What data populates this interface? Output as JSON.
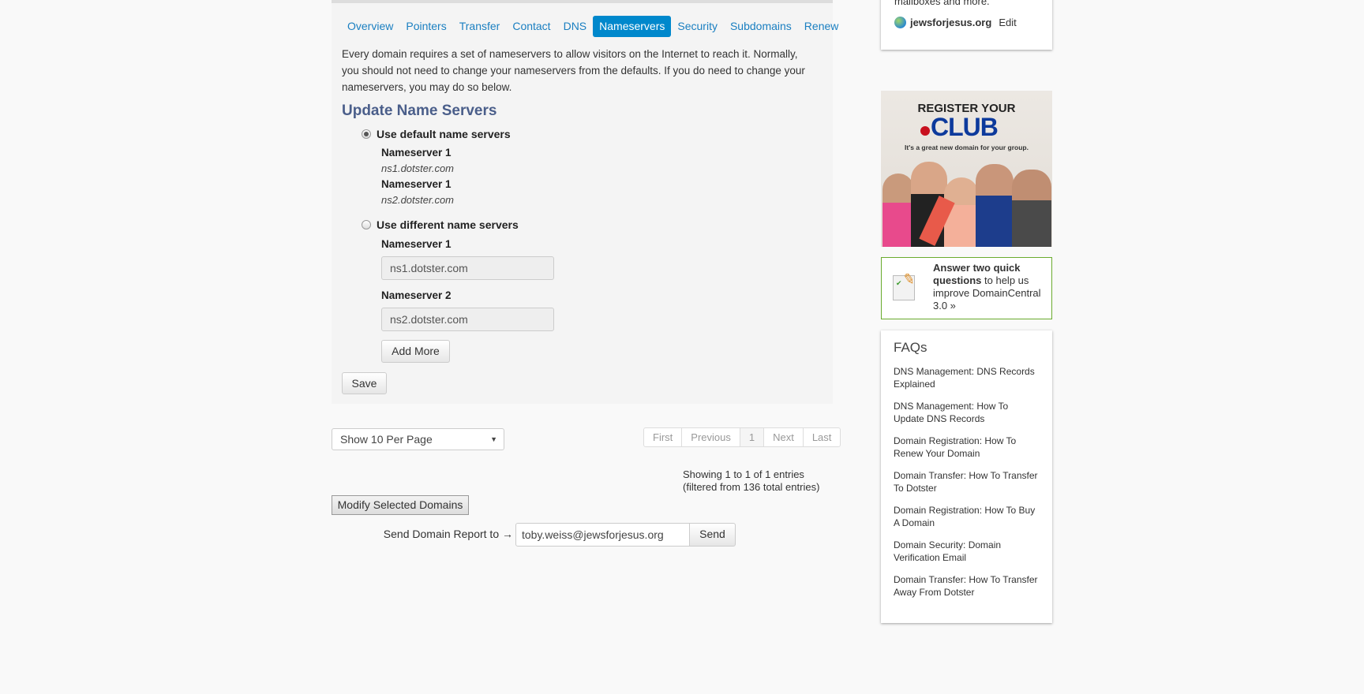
{
  "tabs": [
    {
      "label": "Overview"
    },
    {
      "label": "Pointers"
    },
    {
      "label": "Transfer"
    },
    {
      "label": "Contact"
    },
    {
      "label": "DNS"
    },
    {
      "label": "Nameservers",
      "active": true
    },
    {
      "label": "Security"
    },
    {
      "label": "Subdomains"
    },
    {
      "label": "Renew"
    }
  ],
  "intro": "Every domain requires a set of nameservers to allow visitors on the Internet to reach it. Normally, you should not need to change your nameservers from the defaults. If you do need to change your nameservers, you may do so below.",
  "heading": "Update Name Servers",
  "default_option": {
    "label": "Use default name servers",
    "selected": true,
    "servers": [
      {
        "label": "Nameserver 1",
        "value": "ns1.dotster.com"
      },
      {
        "label": "Nameserver 1",
        "value": "ns2.dotster.com"
      }
    ]
  },
  "custom_option": {
    "label": "Use different name servers",
    "selected": false,
    "fields": [
      {
        "label": "Nameserver 1",
        "value": "ns1.dotster.com"
      },
      {
        "label": "Nameserver 2",
        "value": "ns2.dotster.com"
      }
    ]
  },
  "add_more": "Add More",
  "save": "Save",
  "per_page": "Show 10 Per Page",
  "pagination": [
    "First",
    "Previous",
    "1",
    "Next",
    "Last"
  ],
  "showing": "Showing 1 to 1 of 1 entries",
  "filtered": "(filtered from 136 total entries)",
  "modify": "Modify Selected Domains",
  "report_label": "Send Domain Report to →",
  "report_email": "toby.weiss@jewsforjesus.org",
  "send": "Send",
  "sidebar": {
    "email_text": "mailboxes and more.",
    "domain": "jewsforjesus.org",
    "edit": "Edit",
    "ad": {
      "line1": "REGISTER YOUR",
      "line2": "CLUB",
      "tagline": "It's a great new domain for your group."
    },
    "survey": {
      "bold": "Answer two quick questions",
      "rest": " to help us improve DomainCentral 3.0 »"
    },
    "faq_title": "FAQs",
    "faqs": [
      "DNS Management: DNS Records Explained",
      "DNS Management: How To Update DNS Records",
      "Domain Registration: How To Renew Your Domain",
      "Domain Transfer: How To Transfer To Dotster",
      "Domain Registration: How To Buy A Domain",
      "Domain Security: Domain Verification Email",
      "Domain Transfer: How To Transfer Away From Dotster"
    ]
  },
  "colors": {
    "accent": "#0088cc",
    "heading": "#4a5e8a",
    "survey_border": "#6aab2e"
  }
}
